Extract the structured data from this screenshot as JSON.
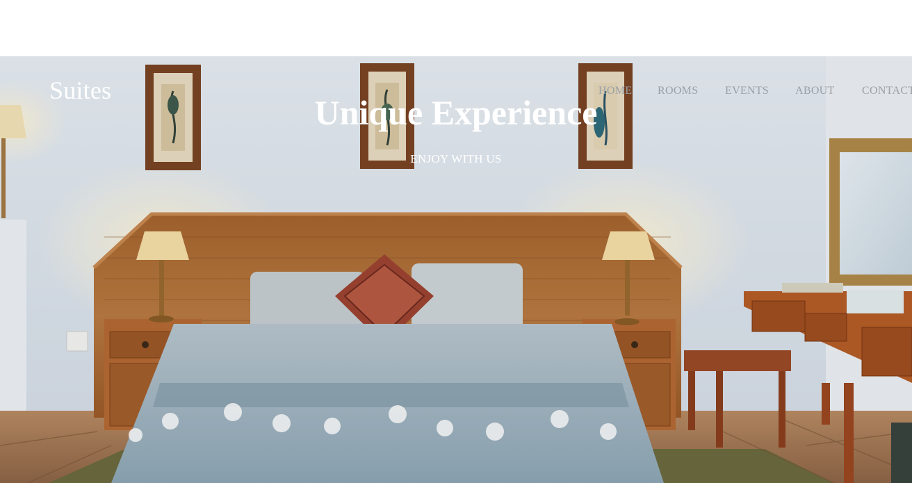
{
  "site": {
    "brand": "Suites"
  },
  "nav": {
    "items": [
      "HOME",
      "ROOMS",
      "EVENTS",
      "ABOUT",
      "CONTACT"
    ]
  },
  "hero": {
    "title": "Unique Experience",
    "subtitle": "ENJOY WITH US",
    "image": "hotel-bedroom-photo"
  },
  "colors": {
    "nav_text": "#9aa0a6",
    "hero_text": "#ffffff",
    "wall": "#dfe6ee",
    "headboard": "#b0703a",
    "bedspread": "#9fb6c3"
  }
}
